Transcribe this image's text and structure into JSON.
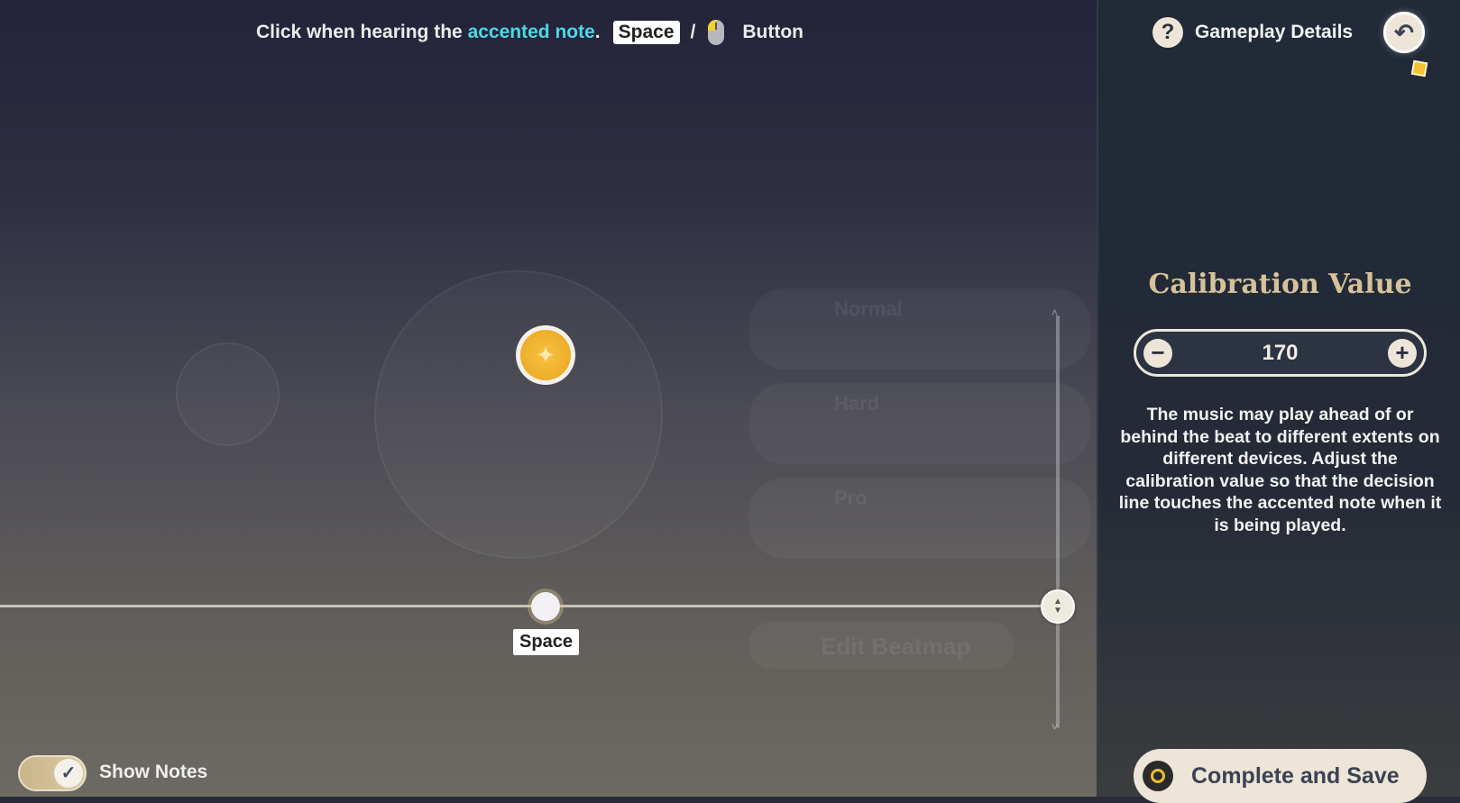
{
  "hint": {
    "prefix": "Click when hearing the ",
    "accent": "accented note",
    "suffix": ".",
    "key": "Space",
    "separator": "/",
    "mouse_icon": "mouse-left-button-icon",
    "button": "Button",
    "accent_color": "#4fd6e6"
  },
  "background": {
    "ghost_items": [
      "Normal",
      "Hard",
      "Pro"
    ],
    "edit_beatmap": "Edit Beatmap"
  },
  "track": {
    "note_icon": "sparkle-icon",
    "decision_key": "Space"
  },
  "show_notes": {
    "label": "Show Notes",
    "checked": true
  },
  "panel": {
    "details_label": "Gameplay Details",
    "calibration_title": "Calibration Value",
    "calibration_value": "170",
    "minus": "−",
    "plus": "+",
    "description": "The music may play ahead of or behind the beat to different extents on different devices. Adjust the calibration value so that the decision line touches the accented note when it is being played.",
    "save_label": "Complete and Save"
  }
}
